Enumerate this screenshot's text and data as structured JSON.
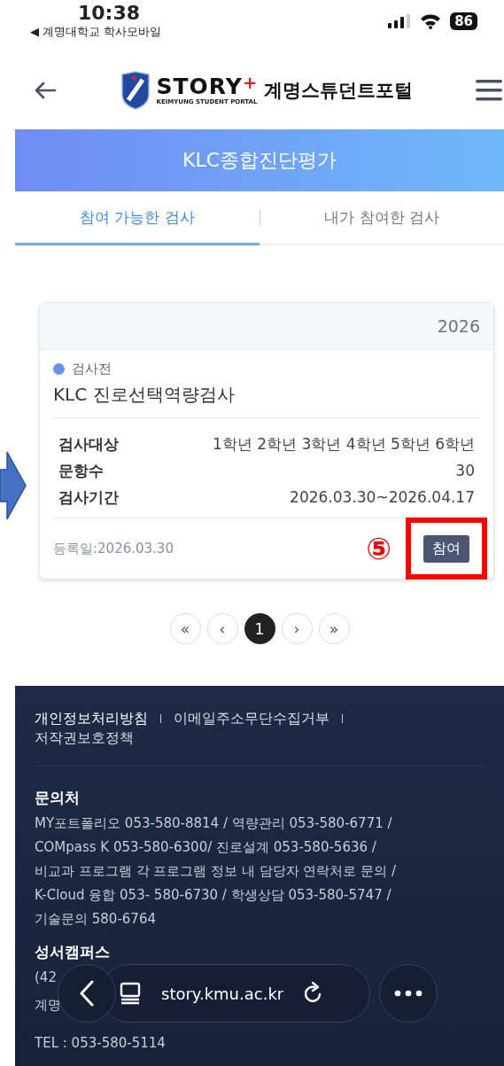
{
  "status_bar": {
    "time": "10:38",
    "back_app": "◀ 계명대학교 학사모바일",
    "battery": "86"
  },
  "header": {
    "logo_word": "STORY",
    "logo_plus": "+",
    "logo_sub": "KEIMYUNG STUDENT PORTAL",
    "title": "계명스튜던트포털"
  },
  "banner": {
    "title": "KLC종합진단평가"
  },
  "tabs": [
    {
      "label": "참여 가능한 검사",
      "selected": true
    },
    {
      "label": "내가 참여한 검사",
      "selected": false
    }
  ],
  "card": {
    "year": "2026",
    "status": {
      "label": "검사전",
      "color": "#6b8cf0"
    },
    "title": "KLC 진로선택역량검사",
    "rows": [
      {
        "label": "검사대상",
        "value": "1학년 2학년 3학년 4학년 5학년 6학년"
      },
      {
        "label": "문항수",
        "value": "30"
      },
      {
        "label": "검사기간",
        "value": "2026.03.30~2026.04.17"
      }
    ],
    "registered": "등록일:2026.03.30",
    "button": "참여"
  },
  "annotation": {
    "marker": "⑤"
  },
  "pagination": [
    {
      "label": "«",
      "selected": false
    },
    {
      "label": "‹",
      "selected": false
    },
    {
      "label": "1",
      "selected": true
    },
    {
      "label": "›",
      "selected": false
    },
    {
      "label": "»",
      "selected": false
    }
  ],
  "footer": {
    "links": [
      "개인정보처리방침",
      "이메일주소무단수집거부",
      "저작권보호정책"
    ],
    "sections": [
      {
        "heading": "문의처",
        "lines": [
          "MY포트폴리오 053-580-8814 / 역량관리 053-580-6771 /",
          "COMpass K 053-580-6300/ 진로설계 053-580-5636 /",
          "비교과 프로그램 각 프로그램 정보 내 담당자 연락처로 문의 /",
          "K-Cloud 융합 053- 580-6730 / 학생상담 053-580-5747 /",
          "기술문의 580-6764"
        ]
      },
      {
        "heading": "성서캠퍼스",
        "lines": [
          "(42",
          "계명",
          "TEL : 053-580-5114"
        ]
      }
    ]
  },
  "browser_bar": {
    "url": "story.kmu.ac.kr"
  }
}
